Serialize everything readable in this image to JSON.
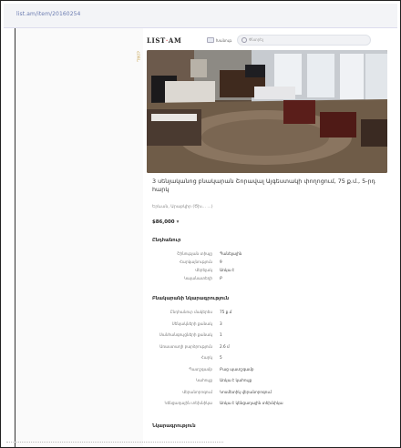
{
  "browser": {
    "url": "list.am/item/20160254"
  },
  "header": {
    "logo_main": "LIST",
    "logo_accent": "·",
    "logo_end": "AM",
    "nav_label": "Խանութ",
    "search_placeholder": "Փնտրել"
  },
  "sidebar": {
    "badge": "ՀՈԳՆ"
  },
  "listing": {
    "title": "3 սենյականոց բնակարան Շորավալ Այգեստակի փողոցում, 75 ք.մ., 5-րդ հարկ",
    "subtitle": "Երևան, Արաբկիր (Ծխ... ...)",
    "price": "$86,000",
    "price_currency": "▾"
  },
  "general": {
    "title": "Ընդհանուր",
    "rows": [
      {
        "k": "Շինության տիպը",
        "v": "Պանելային"
      },
      {
        "k": "Հարկայնություն",
        "v": "9"
      },
      {
        "k": "Վերելակ",
        "v": "Առկա է"
      },
      {
        "k": "Կայանատեղի",
        "v": "Բ"
      }
    ]
  },
  "apartment": {
    "title": "Բնակարանի նկարագրություն",
    "rows": [
      {
        "k": "Ընդհանուր մակերես",
        "v": "75 ք.մ"
      },
      {
        "k": "Սենյակների քանակ",
        "v": "3"
      },
      {
        "k": "Սանհանգույցների քանակ",
        "v": "1"
      },
      {
        "k": "Առաստաղի բարձրություն",
        "v": "2.6 մ"
      },
      {
        "k": "Հարկ",
        "v": "5"
      },
      {
        "k": "Պատշգամբ",
        "v": "Բաց պատշգամբ"
      },
      {
        "k": "Կահույք",
        "v": "Առկա է կահույք"
      },
      {
        "k": "Վերանորոգում",
        "v": "Կոսմետիկ վերանորոգում"
      },
      {
        "k": "Կենցաղային տեխնիկա",
        "v": "Առկա է կենցաղային տեխնիկա"
      }
    ]
  },
  "description": {
    "title": "Նկարագրություն"
  }
}
